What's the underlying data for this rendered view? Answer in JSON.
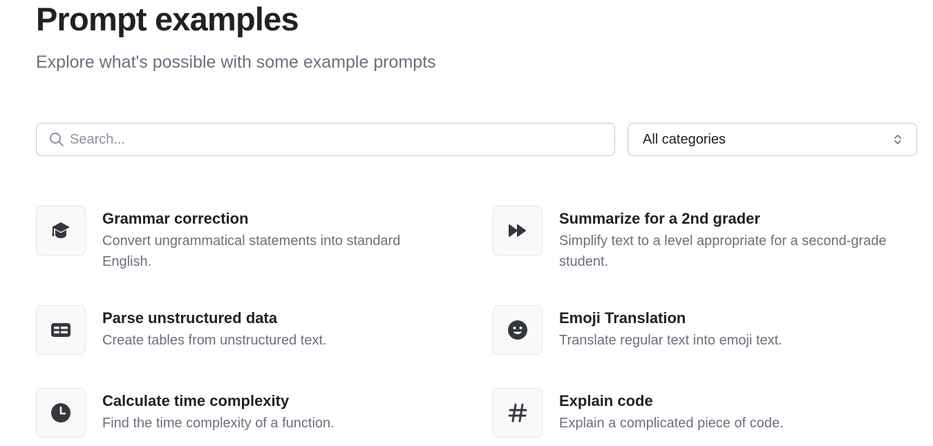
{
  "header": {
    "title": "Prompt examples",
    "subtitle": "Explore what's possible with some example prompts"
  },
  "search": {
    "placeholder": "Search...",
    "value": "",
    "icon": "search-icon"
  },
  "category_select": {
    "selected": "All categories",
    "icon": "chevron-up-down-icon"
  },
  "examples": [
    {
      "title": "Grammar correction",
      "description": "Convert ungrammatical statements into standard English.",
      "icon": "graduation-cap-icon"
    },
    {
      "title": "Summarize for a 2nd grader",
      "description": "Simplify text to a level appropriate for a second-grade student.",
      "icon": "fast-forward-icon"
    },
    {
      "title": "Parse unstructured data",
      "description": "Create tables from unstructured text.",
      "icon": "table-icon"
    },
    {
      "title": "Emoji Translation",
      "description": "Translate regular text into emoji text.",
      "icon": "smiley-face-icon"
    },
    {
      "title": "Calculate time complexity",
      "description": "Find the time complexity of a function.",
      "icon": "clock-icon"
    },
    {
      "title": "Explain code",
      "description": "Explain a complicated piece of code.",
      "icon": "hashtag-icon"
    }
  ],
  "colors": {
    "text_primary": "#202123",
    "text_secondary": "#6e6e80",
    "border": "#c5c5d2",
    "icon_fill": "#353740"
  }
}
